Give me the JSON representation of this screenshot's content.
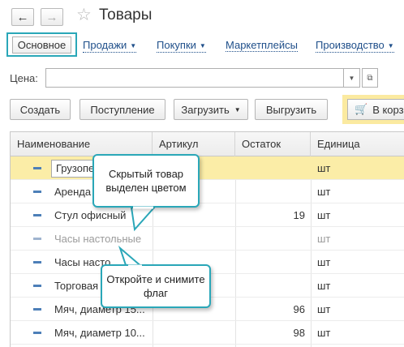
{
  "window": {
    "title": "Товары"
  },
  "nav": {
    "back_icon": "arrow-left-icon",
    "forward_icon": "arrow-right-icon",
    "favorite_icon": "star-icon"
  },
  "tabs": [
    {
      "label": "Основное",
      "active": true
    },
    {
      "label": "Продажи",
      "has_menu": true
    },
    {
      "label": "Покупки",
      "has_menu": true
    },
    {
      "label": "Маркетплейсы",
      "has_menu": false
    },
    {
      "label": "Производство",
      "has_menu": true
    }
  ],
  "filter": {
    "label": "Цена:",
    "value": ""
  },
  "toolbar": {
    "create_label": "Создать",
    "receipt_label": "Поступление",
    "load_label": "Загрузить",
    "unload_label": "Выгрузить",
    "cart_label": "В корз"
  },
  "table": {
    "columns": [
      "Наименование",
      "Артикул",
      "Остаток",
      "Единица"
    ],
    "rows": [
      {
        "name": "Грузопе",
        "article": "",
        "stock": "",
        "unit": "шт",
        "selected": true,
        "hidden": false
      },
      {
        "name": "Аренда",
        "article": "",
        "stock": "",
        "unit": "шт",
        "selected": false,
        "hidden": false
      },
      {
        "name": "Стул офисный",
        "article": "",
        "stock": "19",
        "unit": "шт",
        "selected": false,
        "hidden": false
      },
      {
        "name": "Часы настольные",
        "article": "",
        "stock": "",
        "unit": "шт",
        "selected": false,
        "hidden": true
      },
      {
        "name": "Часы насто",
        "article": "",
        "stock": "",
        "unit": "шт",
        "selected": false,
        "hidden": false
      },
      {
        "name": "Торговая",
        "article": "",
        "stock": "",
        "unit": "шт",
        "selected": false,
        "hidden": false
      },
      {
        "name": "Мяч, диаметр 15...",
        "article": "",
        "stock": "96",
        "unit": "шт",
        "selected": false,
        "hidden": false
      },
      {
        "name": "Мяч, диаметр 10...",
        "article": "",
        "stock": "98",
        "unit": "шт",
        "selected": false,
        "hidden": false
      }
    ]
  },
  "callouts": {
    "hidden_item": "Скрытый товар выделен цветом",
    "uncheck_flag": "Откройте и снимите флаг"
  },
  "colors": {
    "accent": "#2aa7b8",
    "selected_row": "#fbeda7",
    "link": "#1f4f8a"
  }
}
